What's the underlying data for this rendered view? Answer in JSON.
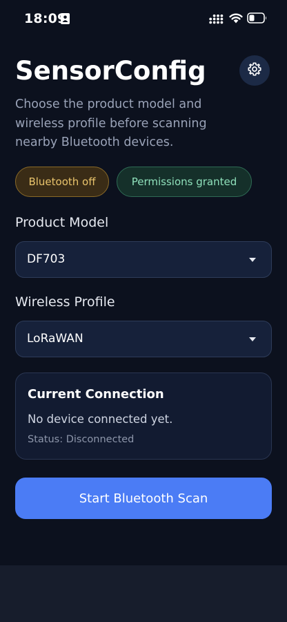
{
  "status_bar": {
    "time": "18:09",
    "icons": [
      "id-card-icon",
      "signal-icon",
      "wifi-icon",
      "battery-icon"
    ]
  },
  "header": {
    "title": "SensorConfig",
    "subtitle": "Choose the product model and wireless profile before scanning nearby Bluetooth devices.",
    "settings_icon": "gear-icon"
  },
  "badges": {
    "bluetooth": "Bluetooth off",
    "permissions": "Permissions granted"
  },
  "product_model": {
    "label": "Product Model",
    "value": "DF703"
  },
  "wireless_profile": {
    "label": "Wireless Profile",
    "value": "LoRaWAN"
  },
  "connection": {
    "title": "Current Connection",
    "message": "No device connected yet.",
    "status": "Status: Disconnected"
  },
  "scan_button": {
    "label": "Start Bluetooth Scan"
  },
  "colors": {
    "background": "#0c111e",
    "accent": "#4b7cf5",
    "warning": "#e9c46c",
    "success": "#8fe0bb"
  }
}
